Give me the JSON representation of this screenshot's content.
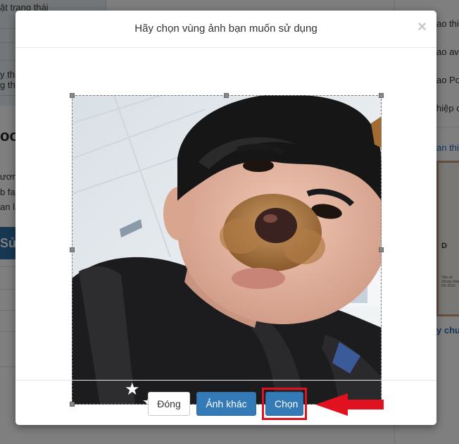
{
  "background": {
    "top_left_text": "ật trang thái",
    "left_fragments": [
      "y thi",
      "g thi",
      "ooc",
      "ươn",
      "b fa",
      "an lá",
      "Sử"
    ],
    "right_fragments": [
      "ao thi",
      "ao av",
      "ao Po",
      "hiệp c",
      "an thi",
      "y chu"
    ],
    "certificate_letter": "D",
    "certificate_small": "Văn số chứng nhận DK-2016"
  },
  "modal": {
    "title": "Hãy chọn vùng ảnh bạn muốn sử dụng",
    "close_symbol": "×",
    "buttons": {
      "close_label": "Đóng",
      "other_image_label": "Ảnh khác",
      "choose_label": "Chọn"
    }
  },
  "colors": {
    "primary": "#337ab7",
    "highlight": "#e0121f",
    "overlay": "rgba(0,0,0,0.5)"
  },
  "icons": {
    "close": "close-icon",
    "arrow": "red-arrow-left-icon"
  }
}
